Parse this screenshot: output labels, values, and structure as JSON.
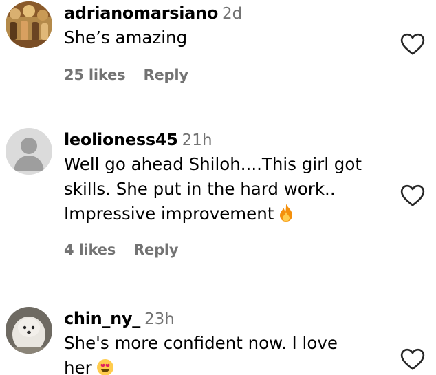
{
  "comments": [
    {
      "username": "adrianomarsiano",
      "time": "2d",
      "lines": [
        "She’s amazing"
      ],
      "likes": "25 likes",
      "reply": "Reply",
      "avatar": "profile-photo"
    },
    {
      "username": "leolioness45",
      "time": "21h",
      "lines": [
        "Well go ahead Shiloh....This girl got",
        "skills. She put in the hard work..",
        "Impressive improvement"
      ],
      "emoji": "fire-emoji",
      "likes": "4 likes",
      "reply": "Reply",
      "avatar": "default-avatar"
    },
    {
      "username": "chin_ny_",
      "time": "23h",
      "lines": [
        "She's more confident now. I love",
        "her"
      ],
      "emoji": "heart-eyes-emoji",
      "avatar": "dog-photo"
    }
  ],
  "colors": {
    "muted": "#737373",
    "text": "#000000",
    "avatar_default_bg": "#c7c7c7",
    "fire": "#f4900c"
  }
}
